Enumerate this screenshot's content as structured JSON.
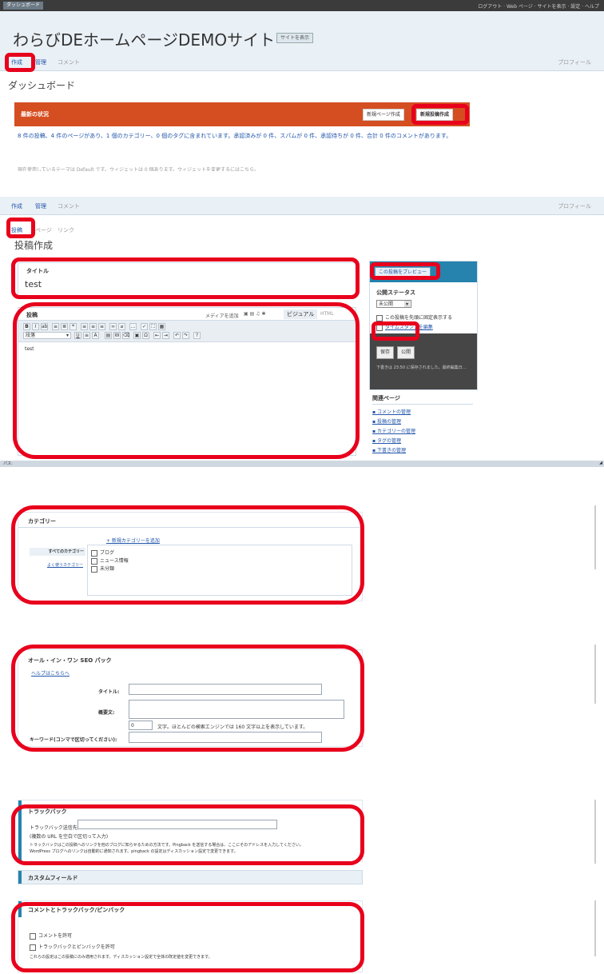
{
  "admin_bar": {
    "logo": "ダッシュボード",
    "right_links": "ログアウト · Web ページ · サイトを表示 · 設定 · ヘルプ"
  },
  "site": {
    "title": "わらびDEホームページDEMOサイト",
    "view_site_button": "サイトを表示"
  },
  "top_nav": {
    "items": [
      "作成",
      "管理",
      "コメント"
    ],
    "right": "プロフィール"
  },
  "dashboard": {
    "heading": "ダッシュボード",
    "banner_title": "最新の状況",
    "write_page_button": "新規ページ作成",
    "write_post_button": "新規投稿作成",
    "status_text": "8 件の投稿、4 件のページがあり、1 個のカテゴリー、0 個のタグに含まれています。承認済みが 0 件、スパムが 0 件、承認待ちが 0 件、合計 0 件のコメントがあります。",
    "trail_text": "現在使用しているテーマは Default です。ウィジェットは 0 個あります。ウィジェットを変更するにはこちら。"
  },
  "editor": {
    "sub_nav": [
      "投稿",
      "ページ",
      "リンク"
    ],
    "heading": "投稿作成",
    "title_label": "タイトル",
    "title_value": "test",
    "body_label": "投稿",
    "add_media": "メディアを追加",
    "visual_tab": "ビジュアル",
    "html_tab": "HTML",
    "body_value": "test",
    "format_select": "段落",
    "status_bar_left": "パス:"
  },
  "sidebar": {
    "preview_button": "この投稿をプレビュー",
    "publish_status_label": "公開ステータス",
    "status_value": "未公開",
    "stick_option": "この投稿を先頭に固定表示する",
    "timestamp_option": "タイムスタンプを編集",
    "save_button": "保存",
    "publish_button": "公開",
    "last_edited": "下書きは 23:50 に保存されました。最終編集日…",
    "related_heading": "関連ページ",
    "related_links": [
      "コメントの管理",
      "投稿の管理",
      "カテゴリーの管理",
      "タグの管理",
      "下書きの管理"
    ]
  },
  "category_box": {
    "title": "カテゴリー",
    "add_link": "+ 新規カテゴリーを追加",
    "tab_all": "すべてのカテゴリー",
    "tab_popular": "よく使うカテゴリー",
    "items": [
      "ブログ",
      "ニュース情報",
      "未分類"
    ]
  },
  "seo_box": {
    "title": "オール・イン・ワン SEO パック",
    "help_link": "ヘルプはこちらへ",
    "title_field_label": "タイトル:",
    "desc_field_label": "概要文:",
    "char_count": "0",
    "char_note": "文字。ほとんどの検索エンジンでは 160 文字以上を表示しています。",
    "keywords_label": "キーワード(コンマで区切ってください):"
  },
  "trackback_box": {
    "title": "トラックバック",
    "send_label": "トラックバック送信先:",
    "separate_note": "(複数の URL を空白で区切って入力)",
    "note_line1": "トラックバックはこの投稿へのリンクを他のブログに知らせるための方法です。Pingback を送信する場合は、ここにそのアドレスを入力してください。",
    "note_line2": "WordPress ブログへのリンクは自動的に通知されます。pingback の設定はディスカッション設定で変更できます。"
  },
  "custom_fields_box": {
    "title": "カスタムフィールド"
  },
  "comments_box": {
    "title": "コメントとトラックバック/ピンバック",
    "allow_comments": "コメントを許可",
    "allow_pings": "トラックバックとピンバックを許可",
    "note": "これらの設定はこの投稿にのみ適用されます。ディスカッション設定で全体の既定値を変更できます。"
  }
}
